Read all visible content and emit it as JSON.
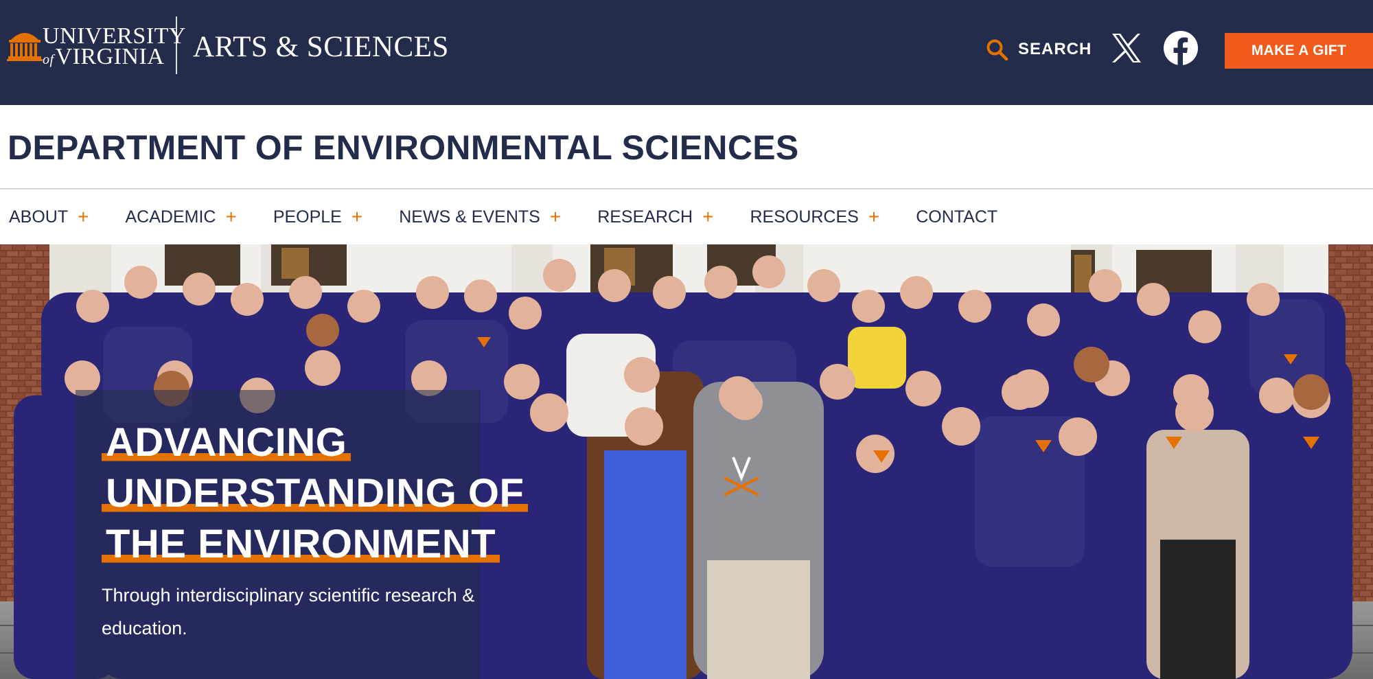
{
  "header": {
    "university": {
      "line1": "UNIVERSITY",
      "of": "of",
      "line2": "VIRGINIA"
    },
    "college": "ARTS & SCIENCES",
    "search_label": "SEARCH",
    "gift_label": "MAKE A GIFT"
  },
  "department": {
    "title": "DEPARTMENT OF ENVIRONMENTAL SCIENCES"
  },
  "nav": {
    "items": [
      {
        "label": "ABOUT",
        "has_submenu": true
      },
      {
        "label": "ACADEMIC",
        "has_submenu": true
      },
      {
        "label": "PEOPLE",
        "has_submenu": true
      },
      {
        "label": "NEWS & EVENTS",
        "has_submenu": true
      },
      {
        "label": "RESEARCH",
        "has_submenu": true
      },
      {
        "label": "RESOURCES",
        "has_submenu": true
      },
      {
        "label": "CONTACT",
        "has_submenu": false
      }
    ],
    "expand_glyph": "+"
  },
  "hero": {
    "heading_lines": [
      "ADVANCING",
      "UNDERSTANDING OF",
      "THE ENVIRONMENT"
    ],
    "subtitle": "Through interdisciplinary scientific research & education."
  },
  "icons": {
    "logo": "rotunda-icon",
    "search": "search-icon",
    "x": "x-icon",
    "facebook": "facebook-icon"
  },
  "colors": {
    "navy": "#232d4b",
    "orange": "#e57200",
    "gift_orange": "#f05a1a",
    "shirt_purple": "#2a2577",
    "brick": "#8b4a35",
    "white": "#ffffff"
  }
}
